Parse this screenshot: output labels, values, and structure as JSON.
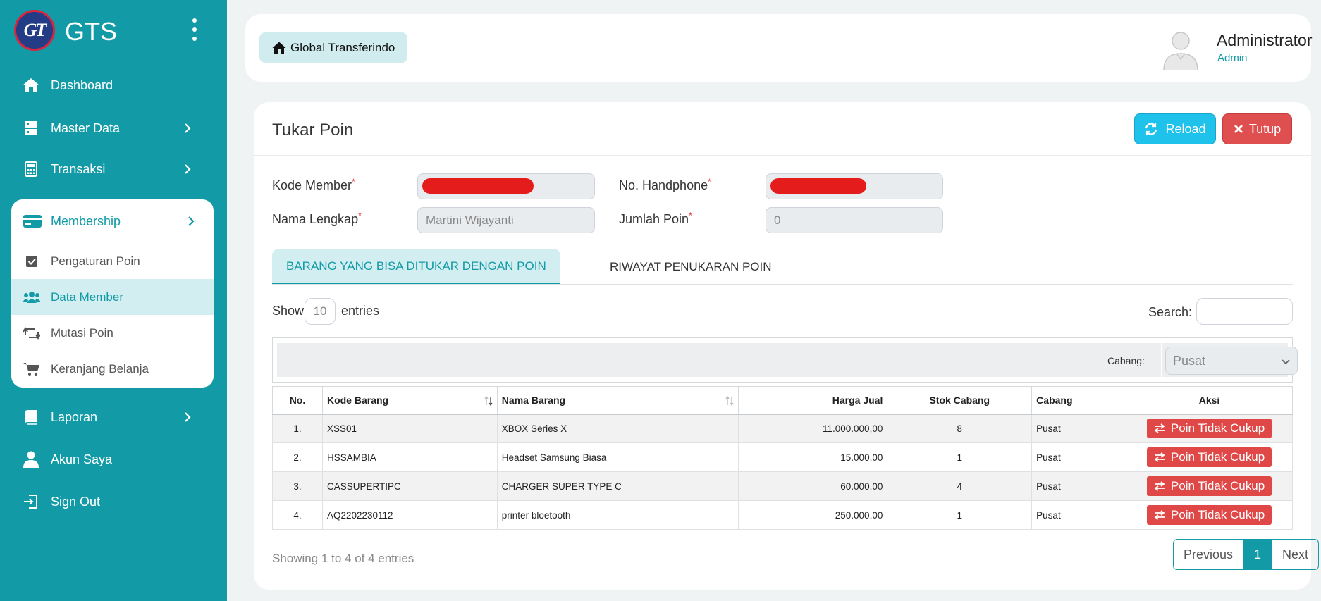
{
  "brand": {
    "name": "GTS",
    "logo_text": "GT"
  },
  "sidebar": {
    "items": [
      {
        "label": "Dashboard"
      },
      {
        "label": "Master Data"
      },
      {
        "label": "Transaksi"
      },
      {
        "label": "Laporan"
      },
      {
        "label": "Akun Saya"
      },
      {
        "label": "Sign Out"
      }
    ],
    "membership": {
      "label": "Membership",
      "sub_items": [
        {
          "label": "Pengaturan Poin"
        },
        {
          "label": "Data Member"
        },
        {
          "label": "Mutasi Poin"
        },
        {
          "label": "Keranjang Belanja"
        }
      ]
    }
  },
  "topbar": {
    "breadcrumb": "Global Transferindo",
    "user_name": "Administrator",
    "user_role": "Admin"
  },
  "page": {
    "title": "Tukar Poin",
    "reload_label": "Reload",
    "close_label": "Tutup"
  },
  "form": {
    "kode_member_label": "Kode Member",
    "no_handphone_label": "No. Handphone",
    "nama_lengkap_label": "Nama Lengkap",
    "nama_lengkap_value": "Martini Wijayanti",
    "jumlah_poin_label": "Jumlah Poin",
    "jumlah_poin_value": "0",
    "required_mark": "*"
  },
  "tabs": [
    {
      "label": "BARANG YANG BISA DITUKAR DENGAN POIN"
    },
    {
      "label": "RIWAYAT PENUKARAN POIN"
    }
  ],
  "table_controls": {
    "show_label": "Show",
    "entries_value": "10",
    "entries_label": "entries",
    "search_label": "Search:",
    "cabang_label": "Cabang:",
    "cabang_value": "Pusat"
  },
  "table": {
    "headers": [
      "No.",
      "Kode Barang",
      "Nama Barang",
      "Harga Jual",
      "Stok Cabang",
      "Cabang",
      "Aksi"
    ],
    "rows": [
      {
        "no": "1.",
        "kode": "XSS01",
        "nama": "XBOX Series X",
        "harga": "11.000.000,00",
        "stok": "8",
        "cabang": "Pusat",
        "aksi": "Poin Tidak Cukup"
      },
      {
        "no": "2.",
        "kode": "HSSAMBIA",
        "nama": "Headset Samsung Biasa",
        "harga": "15.000,00",
        "stok": "1",
        "cabang": "Pusat",
        "aksi": "Poin Tidak Cukup"
      },
      {
        "no": "3.",
        "kode": "CASSUPERTIPC",
        "nama": "CHARGER SUPER TYPE C",
        "harga": "60.000,00",
        "stok": "4",
        "cabang": "Pusat",
        "aksi": "Poin Tidak Cukup"
      },
      {
        "no": "4.",
        "kode": "AQ2202230112",
        "nama": "printer bloetooth",
        "harga": "250.000,00",
        "stok": "1",
        "cabang": "Pusat",
        "aksi": "Poin Tidak Cukup"
      }
    ]
  },
  "footer": {
    "info": "Showing 1 to 4 of 4 entries",
    "previous": "Previous",
    "page": "1",
    "next": "Next"
  },
  "colors": {
    "primary": "#129aa6",
    "reload": "#1fc2ea",
    "danger": "#e04f4f"
  }
}
